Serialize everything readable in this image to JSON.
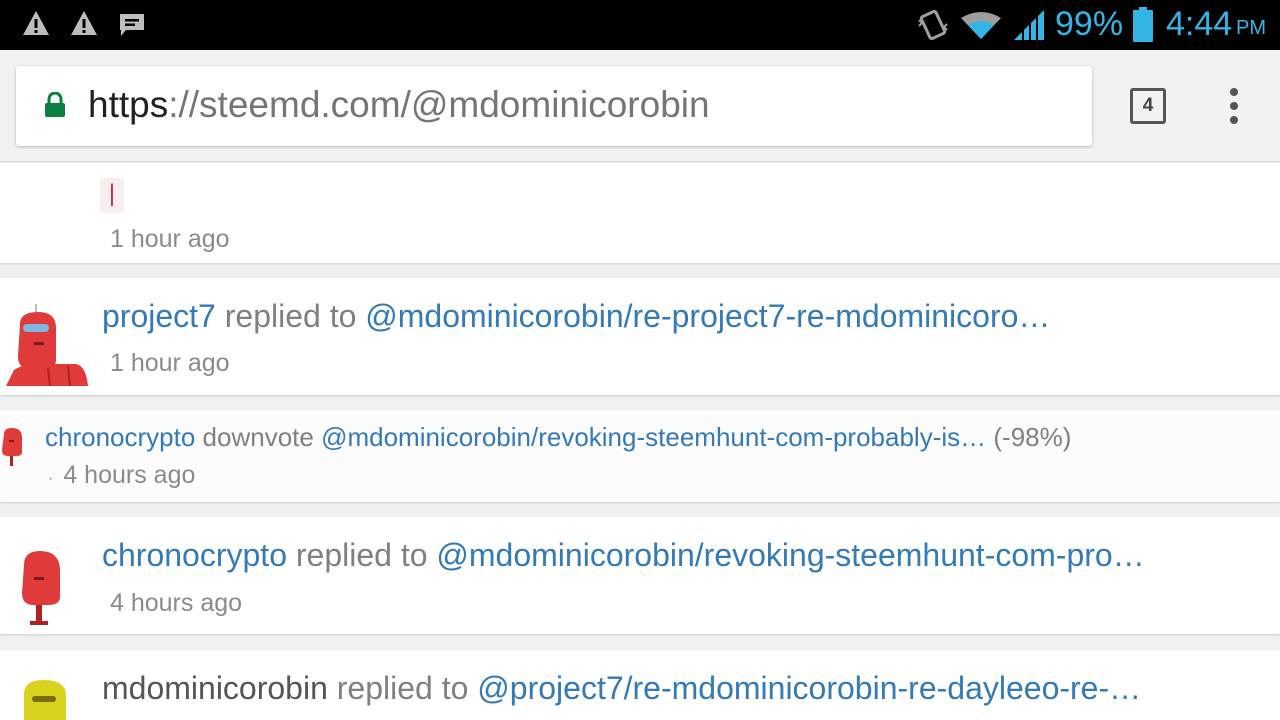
{
  "status_bar": {
    "battery_percent": "99%",
    "time": "4:44",
    "ampm": "PM",
    "icons": [
      "warning-icon",
      "warning-icon",
      "message-icon",
      "vibrate-icon",
      "wifi-icon",
      "signal-icon",
      "battery-icon"
    ],
    "accent_color": "#33b5e5"
  },
  "browser": {
    "url_scheme": "https",
    "url_rest": "://steemd.com/@mdominicorobin",
    "tab_count": "4",
    "lock_color": "#0b8043"
  },
  "feed": {
    "card0": {
      "snippet": "|",
      "time": "1 hour ago"
    },
    "card1": {
      "user": "project7",
      "action": " replied to ",
      "post": "@mdominicorobin/re-project7-re-mdominicoro…",
      "time": "1 hour ago"
    },
    "card2": {
      "user": "chronocrypto",
      "action": " downvote ",
      "post": "@mdominicorobin/revoking-steemhunt-com-probably-is…",
      "weight": " (-98%)",
      "dot": "·",
      "time": "4 hours ago"
    },
    "card3": {
      "user": "chronocrypto",
      "action": " replied to ",
      "post": "@mdominicorobin/revoking-steemhunt-com-pro…",
      "time": "4 hours ago"
    },
    "card4": {
      "user": "mdominicorobin",
      "action": " replied to ",
      "post": "@project7/re-mdominicorobin-re-dayleeo-re-…"
    }
  },
  "colors": {
    "link": "#337ab7",
    "muted": "#808080",
    "avatar_red": "#e03a3a",
    "avatar_yellow": "#d8d21e"
  }
}
